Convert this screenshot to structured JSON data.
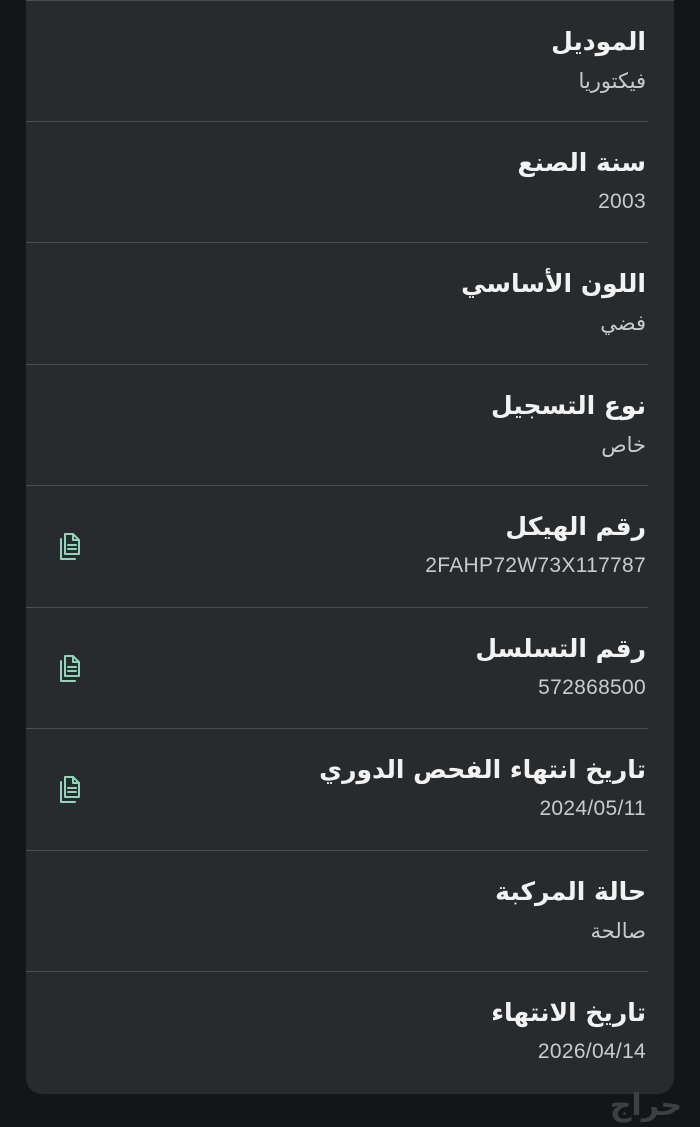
{
  "fields": [
    {
      "label": "الموديل",
      "value": "فيكتوريا",
      "copyable": false,
      "ltr": false
    },
    {
      "label": "سنة الصنع",
      "value": "2003",
      "copyable": false,
      "ltr": true
    },
    {
      "label": "اللون الأساسي",
      "value": "فضي",
      "copyable": false,
      "ltr": false
    },
    {
      "label": "نوع التسجيل",
      "value": "خاص",
      "copyable": false,
      "ltr": false
    },
    {
      "label": "رقم الهيكل",
      "value": "2FAHP72W73X117787",
      "copyable": true,
      "ltr": true
    },
    {
      "label": "رقم التسلسل",
      "value": "572868500",
      "copyable": true,
      "ltr": true
    },
    {
      "label": "تاريخ انتهاء الفحص الدوري",
      "value": "2024/05/11",
      "copyable": true,
      "ltr": true
    },
    {
      "label": "حالة المركبة",
      "value": "صالحة",
      "copyable": false,
      "ltr": false
    },
    {
      "label": "تاريخ الانتهاء",
      "value": "2026/04/14",
      "copyable": false,
      "ltr": true
    }
  ],
  "icons": {
    "copy": "copy-icon"
  },
  "colors": {
    "background": "#141516",
    "card": "#282b2d",
    "accent": "#8fd6b8"
  },
  "watermark": "حراج"
}
